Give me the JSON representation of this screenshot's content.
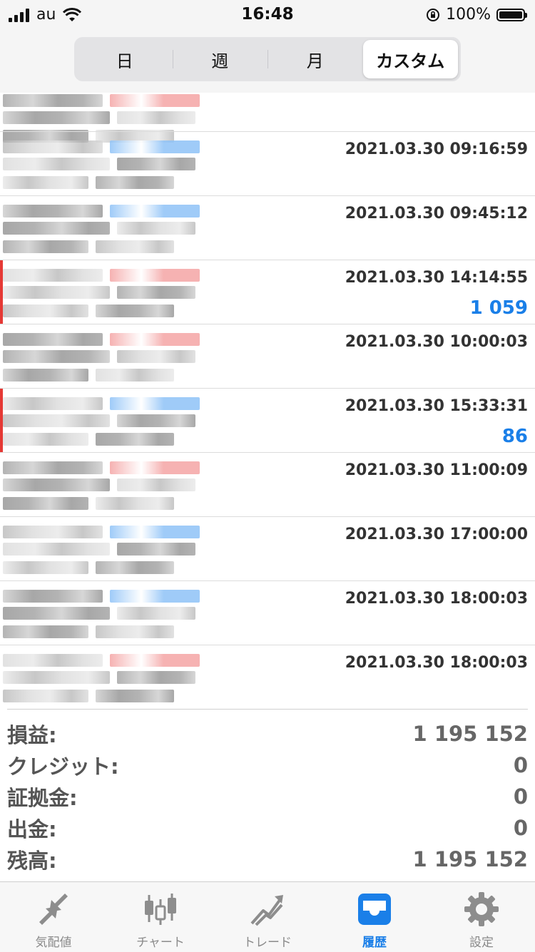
{
  "status_bar": {
    "carrier": "au",
    "time": "16:48",
    "battery": "100%"
  },
  "segments": [
    {
      "label": "日",
      "active": false
    },
    {
      "label": "週",
      "active": false
    },
    {
      "label": "月",
      "active": false
    },
    {
      "label": "カスタム",
      "active": true
    }
  ],
  "history_rows": [
    {
      "timestamp": "",
      "profit": "",
      "direction": "sell",
      "closed": false
    },
    {
      "timestamp": "2021.03.30 09:16:59",
      "profit": "",
      "direction": "buy",
      "closed": false
    },
    {
      "timestamp": "2021.03.30 09:45:12",
      "profit": "",
      "direction": "buy",
      "closed": false
    },
    {
      "timestamp": "2021.03.30 14:14:55",
      "profit": "1 059",
      "direction": "sell",
      "closed": true
    },
    {
      "timestamp": "2021.03.30 10:00:03",
      "profit": "",
      "direction": "sell",
      "closed": false
    },
    {
      "timestamp": "2021.03.30 15:33:31",
      "profit": "86",
      "direction": "buy",
      "closed": true
    },
    {
      "timestamp": "2021.03.30 11:00:09",
      "profit": "",
      "direction": "sell",
      "closed": false
    },
    {
      "timestamp": "2021.03.30 17:00:00",
      "profit": "",
      "direction": "buy",
      "closed": false
    },
    {
      "timestamp": "2021.03.30 18:00:03",
      "profit": "",
      "direction": "buy",
      "closed": false
    },
    {
      "timestamp": "2021.03.30 18:00:03",
      "profit": "",
      "direction": "sell",
      "closed": false
    }
  ],
  "summary": {
    "profit_label": "損益:",
    "profit_value": "1 195 152",
    "credit_label": "クレジット:",
    "credit_value": "0",
    "margin_label": "証拠金:",
    "margin_value": "0",
    "withdrawal_label": "出金:",
    "withdrawal_value": "0",
    "balance_label": "残高:",
    "balance_value": "1 195 152"
  },
  "tabs": [
    {
      "label": "気配値",
      "icon": "quotes-arrows-icon",
      "active": false
    },
    {
      "label": "チャート",
      "icon": "candlestick-chart-icon",
      "active": false
    },
    {
      "label": "トレード",
      "icon": "trade-trend-icon",
      "active": false
    },
    {
      "label": "履歴",
      "icon": "history-inbox-icon",
      "active": true
    },
    {
      "label": "設定",
      "icon": "settings-gear-icon",
      "active": false
    }
  ],
  "colors": {
    "accent": "#1a7fe8",
    "closed_stripe": "#e53935",
    "buy_blur": "#8ec2f7",
    "sell_blur": "#f4a4a4"
  }
}
